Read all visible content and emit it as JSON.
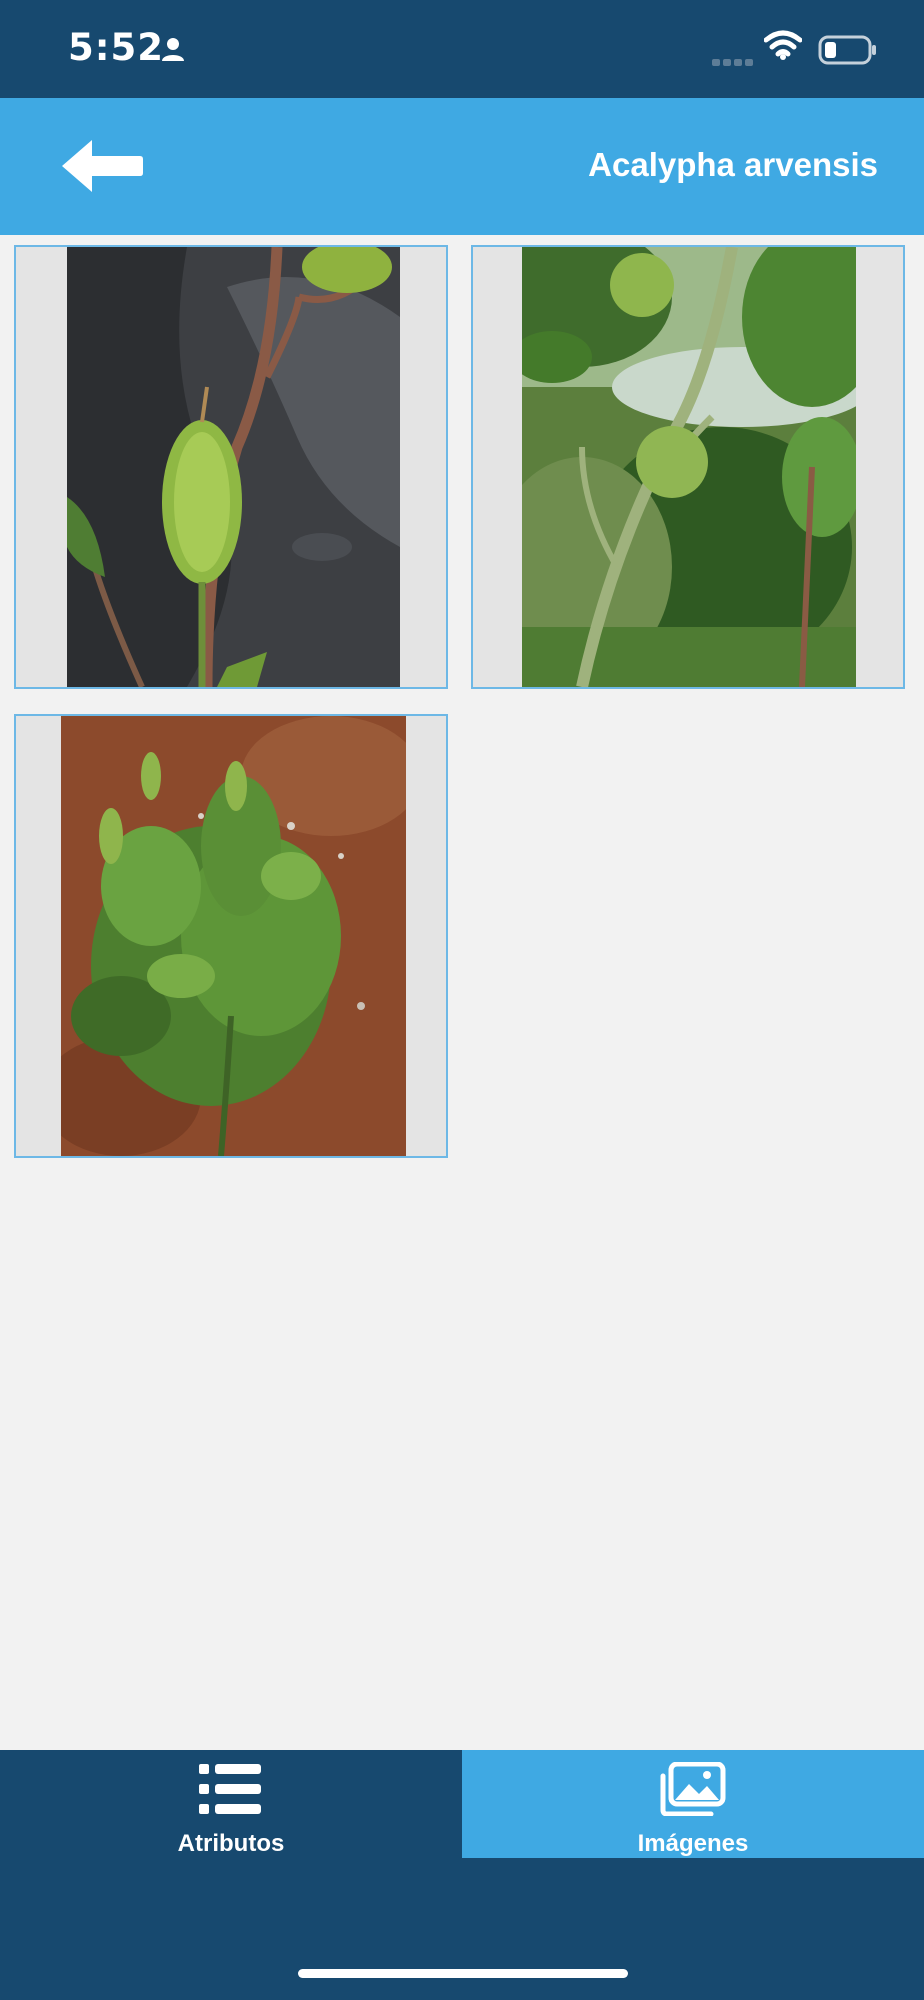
{
  "status_bar": {
    "time": "5:52",
    "icons": [
      "person-icon",
      "signal-icon",
      "wifi-icon",
      "battery-icon"
    ]
  },
  "header": {
    "back_icon": "arrow-left-icon",
    "title": "Acalypha arvensis"
  },
  "gallery": {
    "images": [
      {
        "subject": "Acalypha arvensis flower spike close-up"
      },
      {
        "subject": "Acalypha arvensis stem with spikes outdoors"
      },
      {
        "subject": "Acalypha arvensis plant on red soil"
      }
    ]
  },
  "tabs": [
    {
      "label": "Atributos",
      "icon": "list-icon",
      "active": false
    },
    {
      "label": "Imágenes",
      "icon": "images-icon",
      "active": true
    }
  ],
  "colors": {
    "status_bar": "#17496f",
    "header": "#3fa9e3",
    "tab_bar": "#17496f",
    "tab_active": "#3fa9e3",
    "background": "#f2f2f2"
  }
}
